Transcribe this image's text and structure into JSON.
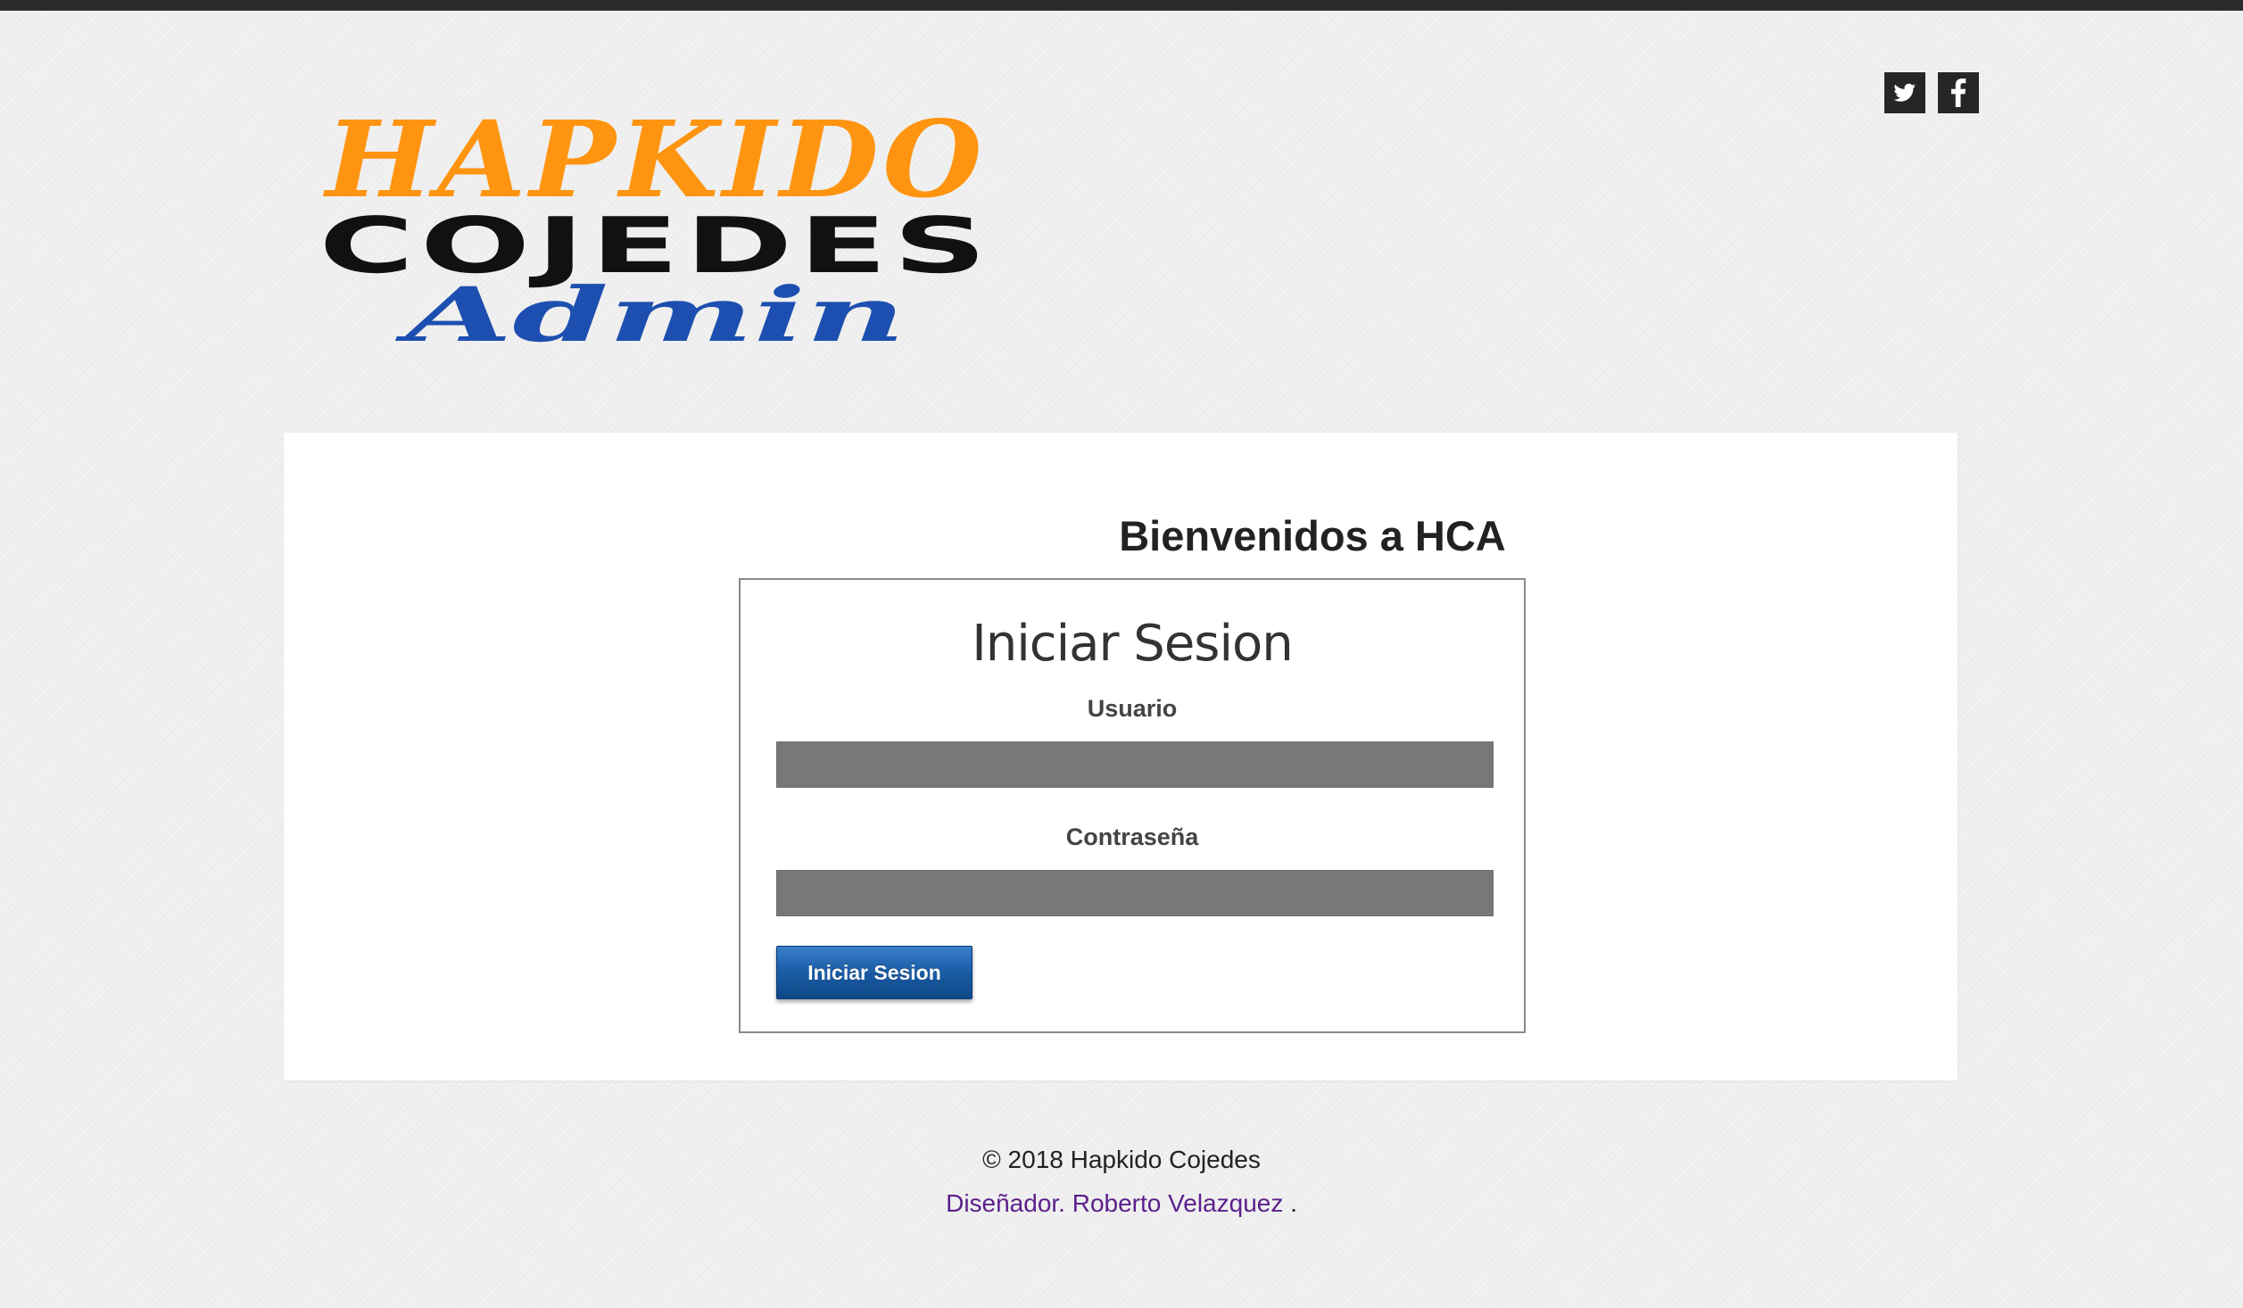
{
  "logo": {
    "line1": "HAPKIDO",
    "line2": "COJEDES",
    "line3": "Admin",
    "colors": {
      "line1": "#ff9410",
      "line2": "#111111",
      "line3": "#1d4fb0"
    }
  },
  "social": [
    {
      "name": "twitter",
      "icon": "twitter-icon"
    },
    {
      "name": "facebook",
      "icon": "facebook-icon"
    }
  ],
  "main": {
    "welcome": "Bienvenidos a HCA",
    "login": {
      "title": "Iniciar Sesion",
      "username_label": "Usuario",
      "username_value": "",
      "password_label": "Contraseña",
      "password_value": "",
      "submit_label": "Iniciar Sesion"
    }
  },
  "footer": {
    "copyright": "© 2018 Hapkido Cojedes",
    "designer_link": "Diseñador. Roberto Velazquez",
    "designer_suffix": " ."
  },
  "colors": {
    "topbar": "#2b2b2b",
    "background": "#efefef",
    "panel": "#ffffff",
    "input_fill": "#787878",
    "button": "#1c5ea8",
    "link": "#5b1f8c"
  }
}
